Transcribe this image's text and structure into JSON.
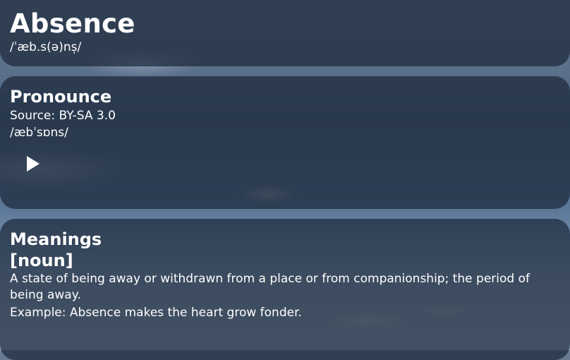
{
  "word": {
    "title": "Absence",
    "phonetic": "/ˈæb.s(ə)ns̩/"
  },
  "pronounce": {
    "heading": "Pronounce",
    "source": "Source: BY-SA 3.0",
    "phonetic": "/æbˈsɒns/",
    "play_icon": "play-icon"
  },
  "meanings": {
    "heading": "Meanings",
    "part_of_speech": "[noun]",
    "definition": "A state of being away or withdrawn from a place or from companionship; the period of being away.",
    "example": "Example: Absence makes the heart grow fonder."
  },
  "colors": {
    "card_background": "rgba(28,40,58,0.72)",
    "text": "#ffffff"
  }
}
